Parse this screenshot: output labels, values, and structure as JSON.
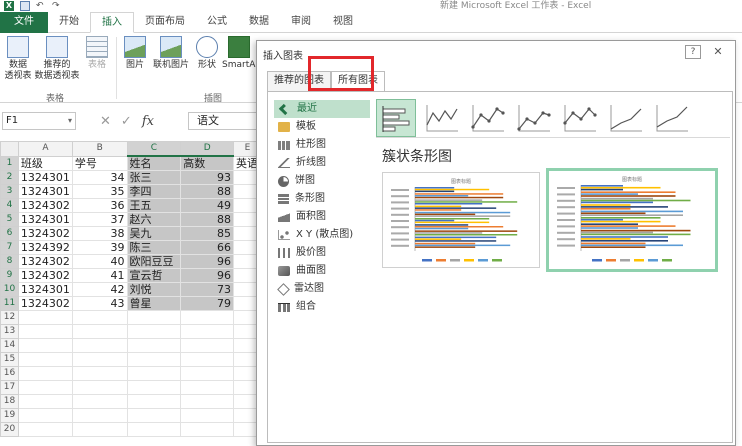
{
  "window": {
    "title": "新建 Microsoft Excel 工作表 - Excel"
  },
  "qat": {
    "excel_icon": "X",
    "undo_glyph": "↶",
    "redo_glyph": "↷"
  },
  "ribbon": {
    "tabs": [
      "文件",
      "开始",
      "插入",
      "页面布局",
      "公式",
      "数据",
      "审阅",
      "视图"
    ],
    "active_tab": "插入",
    "buttons": {
      "pivot": "数据\n透视表",
      "recommended_pivot": "推荐的\n数据透视表",
      "table": "表格",
      "pictures": "图片",
      "online_pictures": "联机图片",
      "shapes": "形状",
      "smartart": "SmartArt"
    },
    "groups": {
      "tables": "表格",
      "illustrations": "插图"
    }
  },
  "formula_bar": {
    "name_box": "F1",
    "cancel": "✕",
    "enter": "✓",
    "fx": "fx",
    "content": "语文"
  },
  "sheet": {
    "columns": [
      "A",
      "B",
      "C",
      "D",
      "E"
    ],
    "rows": [
      [
        "班级",
        "学号",
        "姓名",
        "高数",
        "英语"
      ],
      [
        "1324301",
        "34",
        "张三",
        "93",
        ""
      ],
      [
        "1324301",
        "35",
        "李四",
        "88",
        ""
      ],
      [
        "1324302",
        "36",
        "王五",
        "49",
        ""
      ],
      [
        "1324301",
        "37",
        "赵六",
        "88",
        ""
      ],
      [
        "1324302",
        "38",
        "吴九",
        "85",
        ""
      ],
      [
        "1324392",
        "39",
        "陈三",
        "66",
        ""
      ],
      [
        "1324302",
        "40",
        "欧阳豆豆",
        "96",
        ""
      ],
      [
        "1324302",
        "41",
        "宣云哲",
        "96",
        ""
      ],
      [
        "1324301",
        "42",
        "刘悦",
        "73",
        ""
      ],
      [
        "1324302",
        "43",
        "曾星",
        "79",
        ""
      ],
      [
        "",
        "",
        "",
        "",
        ""
      ],
      [
        "",
        "",
        "",
        "",
        ""
      ],
      [
        "",
        "",
        "",
        "",
        ""
      ],
      [
        "",
        "",
        "",
        "",
        ""
      ],
      [
        "",
        "",
        "",
        "",
        ""
      ],
      [
        "",
        "",
        "",
        "",
        ""
      ],
      [
        "",
        "",
        "",
        "",
        ""
      ],
      [
        "",
        "",
        "",
        "",
        ""
      ],
      [
        "",
        "",
        "",
        "",
        ""
      ]
    ],
    "row_numbers": [
      "1",
      "2",
      "3",
      "4",
      "5",
      "6",
      "7",
      "8",
      "9",
      "10",
      "11",
      "12",
      "13",
      "14",
      "15",
      "16",
      "17",
      "18",
      "19",
      "20"
    ]
  },
  "dialog": {
    "title": "插入图表",
    "help": "?",
    "close": "✕",
    "tabs": [
      "推荐的图表",
      "所有图表"
    ],
    "active_tab": "所有图表",
    "categories": [
      {
        "label": "最近",
        "icon": "recent-icon"
      },
      {
        "label": "模板",
        "icon": "template-icon"
      },
      {
        "label": "柱形图",
        "icon": "column-chart-icon"
      },
      {
        "label": "折线图",
        "icon": "line-chart-icon"
      },
      {
        "label": "饼图",
        "icon": "pie-chart-icon"
      },
      {
        "label": "条形图",
        "icon": "bar-chart-icon"
      },
      {
        "label": "面积图",
        "icon": "area-chart-icon"
      },
      {
        "label": "X Y (散点图)",
        "icon": "scatter-chart-icon"
      },
      {
        "label": "股价图",
        "icon": "stock-chart-icon"
      },
      {
        "label": "曲面图",
        "icon": "surface-chart-icon"
      },
      {
        "label": "雷达图",
        "icon": "radar-chart-icon"
      },
      {
        "label": "组合",
        "icon": "combo-chart-icon"
      }
    ],
    "active_category": "最近",
    "chart_types": [
      "clustered-bar-icon",
      "3d-line-icon",
      "line-markers-icon",
      "stacked-line-markers-icon",
      "line-markers-alt-icon",
      "line-icon",
      "stacked-line-icon"
    ],
    "subtitle": "簇状条形图",
    "preview_title": "图表标题",
    "selected_preview": 1
  },
  "colors": {
    "excel_green": "#217346",
    "selection_gray": "#c6c6c6",
    "active_category": "#bfe0cc",
    "highlight_red": "#e2272b",
    "series": [
      "#4472c4",
      "#ed7d31",
      "#a5a5a5",
      "#ffc000",
      "#5b9bd5",
      "#70ad47",
      "#264478",
      "#9e480e"
    ]
  }
}
